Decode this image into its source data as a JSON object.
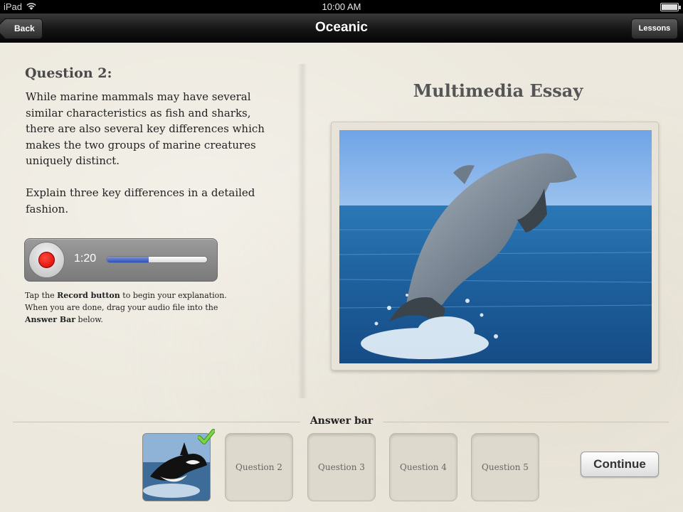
{
  "status_bar": {
    "device": "iPad",
    "time": "10:00 AM"
  },
  "nav_bar": {
    "title": "Oceanic",
    "back_label": "Back",
    "lessons_label": "Lessons"
  },
  "question": {
    "title": "Question 2:",
    "paragraphs": [
      "While marine mammals may have several\nsimilar characteristics as fish and sharks,\nthere are also several key differences which\nmakes the two groups of marine creatures\nuniquely distinct.",
      "Explain three key differences in a detailed\nfashion."
    ]
  },
  "recorder": {
    "time": "1:20",
    "progress": 0.42
  },
  "instructions": {
    "line1_pre": "Tap the ",
    "record_button": "Record button",
    "line1_post": " to begin your explanation.",
    "line2": "When you are done, drag your audio file into the",
    "answer_bar": "Answer Bar",
    "line3_post": " below."
  },
  "essay": {
    "title": "Multimedia Essay",
    "image": "dolphin-leaping-photo"
  },
  "answer_bar": {
    "label": "Answer bar",
    "filled_slot_image": "orca-thumbnail",
    "slots": [
      "Question 2",
      "Question 3",
      "Question 4",
      "Question 5"
    ],
    "continue_label": "Continue"
  },
  "colors": {
    "background": "#ece8dd",
    "record_red": "#e00000",
    "progress_blue": "#3050b8",
    "check_green": "#5cb82c"
  }
}
